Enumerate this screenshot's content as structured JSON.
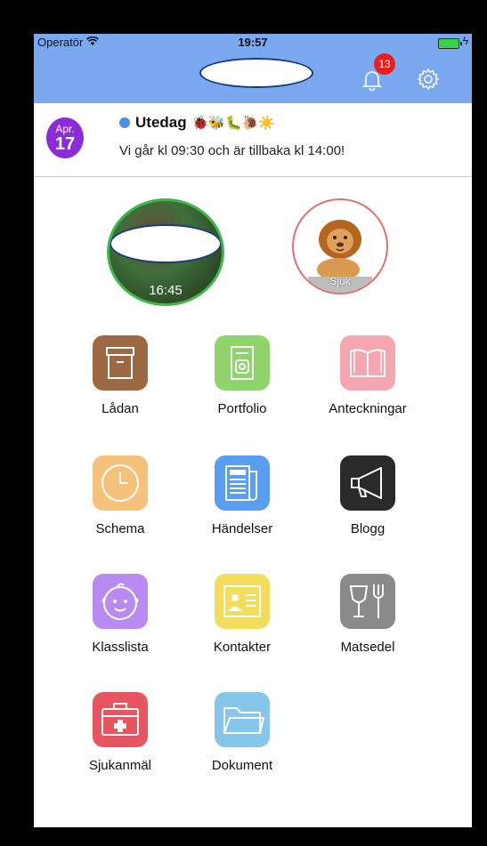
{
  "status": {
    "carrier": "Operatör",
    "time": "19:57"
  },
  "header": {
    "notification_count": "13"
  },
  "event": {
    "month": "Apr.",
    "day": "17",
    "title": "Utedag",
    "emoji": "🐞🐝🐛🐌☀️",
    "description": "Vi går kl 09:30 och är tillbaka kl 14:00!"
  },
  "children": [
    {
      "time": "16:45"
    },
    {
      "status": "Sjuk"
    }
  ],
  "tiles": [
    {
      "label": "Lådan",
      "icon": "box-icon",
      "color": "#9b6a45"
    },
    {
      "label": "Portfolio",
      "icon": "portfolio-icon",
      "color": "#8fd46a"
    },
    {
      "label": "Anteckningar",
      "icon": "book-icon",
      "color": "#f4a7b0"
    },
    {
      "label": "Schema",
      "icon": "clock-icon",
      "color": "#f4c27a"
    },
    {
      "label": "Händelser",
      "icon": "newspaper-icon",
      "color": "#5a9ef2"
    },
    {
      "label": "Blogg",
      "icon": "megaphone-icon",
      "color": "#2a2a2a"
    },
    {
      "label": "Klasslista",
      "icon": "baby-face-icon",
      "color": "#b98af0"
    },
    {
      "label": "Kontakter",
      "icon": "contact-card-icon",
      "color": "#f2dd5c"
    },
    {
      "label": "Matsedel",
      "icon": "cutlery-icon",
      "color": "#8a8a8a"
    },
    {
      "label": "Sjukanmäl",
      "icon": "first-aid-icon",
      "color": "#e85560"
    },
    {
      "label": "Dokument",
      "icon": "folder-icon",
      "color": "#86c6ea"
    }
  ]
}
